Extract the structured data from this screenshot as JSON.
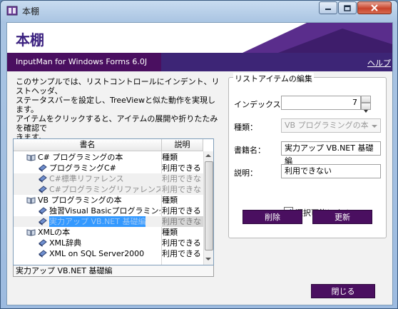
{
  "window": {
    "title": "本棚"
  },
  "header": {
    "title": "本棚"
  },
  "banner": {
    "product": "InputMan for Windows Forms 6.0J",
    "help": "ヘルプ"
  },
  "description": {
    "lines": [
      "このサンプルでは、リストコントロールにインデント、リストヘッダ、",
      "ステータスバーを設定し、TreeViewと似た動作を実現します。",
      "アイテムをクリックすると、アイテムの展開や折りたたみを確認で",
      "きます。"
    ]
  },
  "list": {
    "columns": [
      "書名",
      "説明"
    ],
    "rows": [
      {
        "name": "C# プログラミングの本",
        "status": "種類",
        "indent": 0,
        "icon": "open-book-icon",
        "disabled": false,
        "selected": false
      },
      {
        "name": "プログラミングC#",
        "status": "利用できる",
        "indent": 1,
        "icon": "book-icon",
        "disabled": false,
        "selected": false
      },
      {
        "name": "C#標準リファレンス",
        "status": "利用できな",
        "indent": 1,
        "icon": "book-icon",
        "disabled": true,
        "selected": false
      },
      {
        "name": "C#プログラミングリファレンス",
        "status": "利用できな",
        "indent": 1,
        "icon": "book-icon",
        "disabled": true,
        "selected": false
      },
      {
        "name": "VB プログラミングの本",
        "status": "種類",
        "indent": 0,
        "icon": "open-book-icon",
        "disabled": false,
        "selected": false
      },
      {
        "name": "独習Visual Basicプログラミング",
        "status": "利用できる",
        "indent": 1,
        "icon": "book-icon",
        "disabled": false,
        "selected": false
      },
      {
        "name": "実力アップ VB.NET 基礎編",
        "status": "利用できな",
        "indent": 1,
        "icon": "book-icon",
        "disabled": true,
        "selected": true
      },
      {
        "name": "XMLの本",
        "status": "種類",
        "indent": 0,
        "icon": "open-book-icon",
        "disabled": false,
        "selected": false
      },
      {
        "name": "XML辞典",
        "status": "利用できる",
        "indent": 1,
        "icon": "book-icon",
        "disabled": false,
        "selected": false
      },
      {
        "name": "XML on SQL Server2000",
        "status": "利用できる",
        "indent": 1,
        "icon": "book-icon",
        "disabled": false,
        "selected": false
      }
    ]
  },
  "statusbar": {
    "text": "実力アップ VB.NET 基礎編"
  },
  "edit": {
    "group_title": "リストアイテムの編集",
    "index_label": "インデックス：",
    "index_value": "7",
    "type_label": "種類：",
    "type_value": "VB プログラミングの本",
    "title_label": "書籍名：",
    "title_value": "実力アップ VB.NET 基礎編",
    "desc_label": "説明：",
    "desc_value": "利用できない",
    "selectable_label": "選択可能にする",
    "selectable_checked": true,
    "delete_label": "削除",
    "update_label": "更新"
  },
  "footer": {
    "close_label": "閉じる"
  },
  "colors": {
    "accent": "#4a0f60",
    "banner": "#3d2576",
    "title": "#3c2280",
    "selection": "#3399ff"
  }
}
